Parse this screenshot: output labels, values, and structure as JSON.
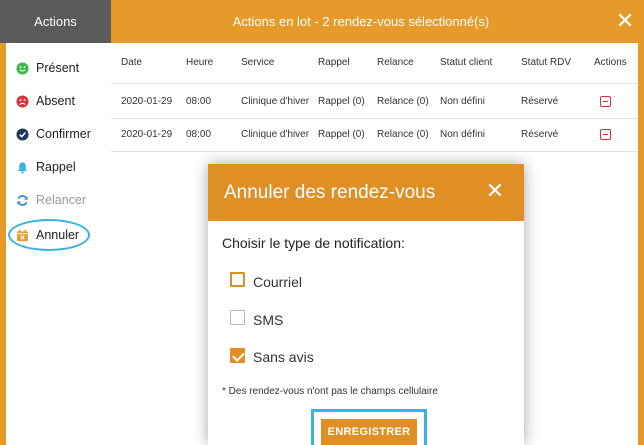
{
  "header": {
    "left_label": "Actions",
    "title": "Actions en lot - 2 rendez-vous sélectionné(s)",
    "close_icon": "close-icon"
  },
  "sidebar": {
    "items": [
      {
        "label": "Présent",
        "icon": "smile-icon",
        "color": "#3cb84a",
        "disabled": false
      },
      {
        "label": "Absent",
        "icon": "frown-icon",
        "color": "#d9323a",
        "disabled": false
      },
      {
        "label": "Confirmer",
        "icon": "check-circle-icon",
        "color": "#1f3a5a",
        "disabled": false
      },
      {
        "label": "Rappel",
        "icon": "bell-icon",
        "color": "#3ab4de",
        "disabled": false
      },
      {
        "label": "Relancer",
        "icon": "refresh-icon",
        "color": "#3a8fd9",
        "disabled": true
      },
      {
        "label": "Annuler",
        "icon": "calendar-x-icon",
        "color": "#e69a2a",
        "disabled": false
      }
    ]
  },
  "table": {
    "columns": [
      "Date",
      "Heure",
      "Service",
      "Rappel",
      "Relance",
      "Statut client",
      "Statut RDV",
      "Actions"
    ],
    "rows": [
      [
        "2020-01-29",
        "08:00",
        "Clinique d'hiver",
        "Rappel (0)",
        "Relance (0)",
        "Non défini",
        "Réservé"
      ],
      [
        "2020-01-29",
        "08:00",
        "Clinique d'hiver",
        "Rappel (0)",
        "Relance (0)",
        "Non défini",
        "Réservé"
      ]
    ],
    "action_icon": "minus-square-icon"
  },
  "modal": {
    "title": "Annuler des rendez-vous",
    "prompt": "Choisir le type de notification:",
    "options": [
      {
        "label": "Courriel",
        "checked": false,
        "enabled": true
      },
      {
        "label": "SMS",
        "checked": false,
        "enabled": false
      },
      {
        "label": "Sans avis",
        "checked": true,
        "enabled": true
      }
    ],
    "note": "* Des rendez-vous n'ont pas le champs cellulaire",
    "save_label": "ENREGISTRER"
  },
  "colors": {
    "accent": "#e69a2a",
    "header_dark": "#5a5a5a",
    "highlight": "#3ab4de",
    "danger": "#d9323a"
  }
}
